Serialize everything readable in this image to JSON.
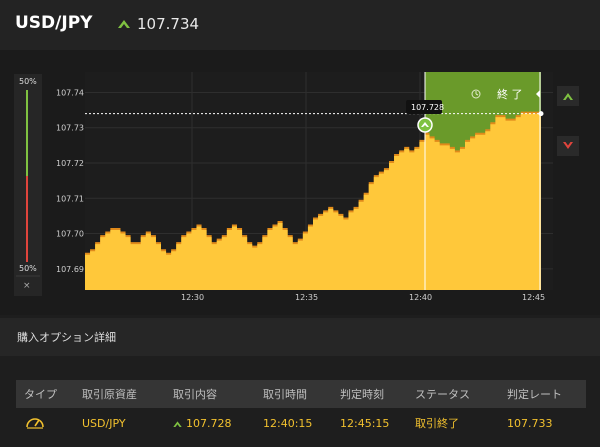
{
  "header": {
    "pair": "USD/JPY",
    "rate": "107.734",
    "rate_direction_icon": "up-arrow-icon",
    "accent_color": "#7fc241"
  },
  "chart": {
    "sentiment_top": "50%",
    "sentiment_bottom": "50%",
    "close_label": "×",
    "y_ticks": [
      "107.74",
      "107.73",
      "107.72",
      "107.71",
      "107.70",
      "107.69"
    ],
    "x_ticks": [
      "12:30",
      "12:35",
      "12:40",
      "12:45"
    ],
    "entry_tooltip": "107.728",
    "end_label": "終 了",
    "high_button_icon": "high-arrow-icon",
    "low_button_icon": "low-arrow-icon",
    "colors": {
      "area": "#ffc83a",
      "area_edge": "#e08a1a",
      "win_zone": "#6a9a2a",
      "high": "#7fc241",
      "low": "#e0443c"
    }
  },
  "chart_data": {
    "type": "area",
    "title": "",
    "xlabel": "",
    "ylabel": "",
    "ylim": [
      107.684,
      107.7458
    ],
    "x_ticks": [
      "12:30",
      "12:35",
      "12:40",
      "12:45"
    ],
    "entry_rate": 107.728,
    "current_rate": 107.734,
    "points": [
      107.694,
      107.695,
      107.697,
      107.699,
      107.7,
      107.701,
      107.701,
      107.7,
      107.699,
      107.697,
      107.697,
      107.699,
      107.7,
      107.699,
      107.697,
      107.695,
      107.694,
      107.695,
      107.697,
      107.699,
      107.7,
      107.701,
      107.702,
      107.701,
      107.699,
      107.697,
      107.698,
      107.699,
      107.701,
      107.702,
      107.701,
      107.699,
      107.697,
      107.696,
      107.697,
      107.699,
      107.701,
      107.702,
      107.703,
      107.701,
      107.699,
      107.697,
      107.698,
      107.7,
      107.702,
      107.704,
      107.705,
      107.706,
      107.707,
      107.706,
      107.705,
      107.704,
      107.706,
      107.707,
      107.709,
      107.711,
      107.714,
      107.716,
      107.717,
      107.718,
      107.72,
      107.722,
      107.723,
      107.724,
      107.723,
      107.724,
      107.726,
      107.728,
      107.727,
      107.726,
      107.725,
      107.725,
      107.724,
      107.723,
      107.724,
      107.726,
      107.727,
      107.728,
      107.728,
      107.729,
      107.731,
      107.733,
      107.733,
      107.732,
      107.732,
      107.733,
      107.734,
      107.734,
      107.734,
      107.734
    ]
  },
  "details": {
    "title": "購入オプション詳細",
    "columns": [
      "タイプ",
      "取引原資産",
      "取引内容",
      "取引時間",
      "判定時刻",
      "ステータス",
      "判定レート"
    ],
    "rows": [
      {
        "type_icon": "gauge-icon",
        "asset": "USD/JPY",
        "content": "107.728",
        "content_icon": "up-arrow-icon",
        "trade_time": "12:40:15",
        "judge_time": "12:45:15",
        "status": "取引終了",
        "judge_rate": "107.733"
      }
    ]
  }
}
